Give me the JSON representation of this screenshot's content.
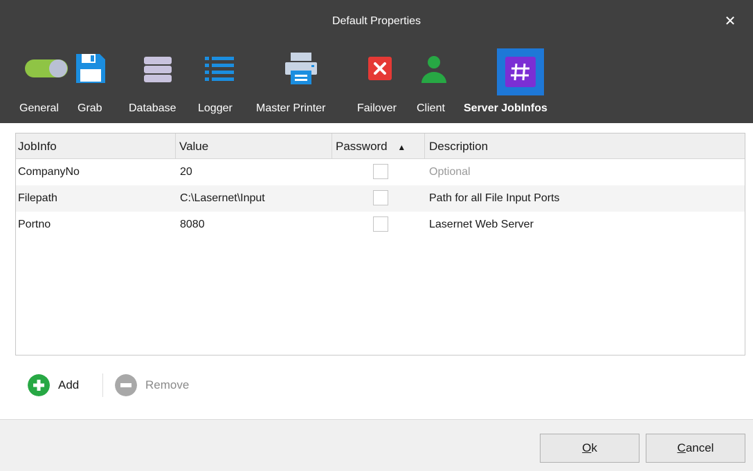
{
  "window": {
    "title": "Default Properties",
    "close_glyph": "✕"
  },
  "toolbar": {
    "items": [
      {
        "label": "General",
        "icon": "toggle-icon"
      },
      {
        "label": "Grab",
        "icon": "floppy-disk-icon"
      },
      {
        "label": "Database",
        "icon": "database-icon"
      },
      {
        "label": "Logger",
        "icon": "list-icon"
      },
      {
        "label": "Master Printer",
        "icon": "printer-icon"
      },
      {
        "label": "Failover",
        "icon": "error-x-icon"
      },
      {
        "label": "Client",
        "icon": "user-icon"
      },
      {
        "label": "Server JobInfos",
        "icon": "hashtag-icon",
        "selected": true
      }
    ],
    "selected_color": "#1e78d7"
  },
  "grid": {
    "columns": [
      "JobInfo",
      "Value",
      "Password",
      "Description"
    ],
    "sort_indicator": "▲",
    "rows": [
      {
        "jobinfo": "CompanyNo",
        "value": "20",
        "password": false,
        "description": "Optional"
      },
      {
        "jobinfo": "Filepath",
        "value": "C:\\Lasernet\\Input",
        "password": false,
        "description": "Path for all File Input Ports"
      },
      {
        "jobinfo": "Portno",
        "value": "8080",
        "password": false,
        "description": "Lasernet Web Server"
      }
    ]
  },
  "actions": {
    "add_label": "Add",
    "remove_label": "Remove"
  },
  "footer": {
    "ok_label": "Ok",
    "ok_mnemonic": "O",
    "ok_rest": "k",
    "cancel_label": "Cancel",
    "cancel_mnemonic": "C",
    "cancel_rest": "ancel"
  },
  "colors": {
    "titlebar": "#404040",
    "add_green": "#27a844",
    "remove_gray": "#a8a8a8"
  }
}
